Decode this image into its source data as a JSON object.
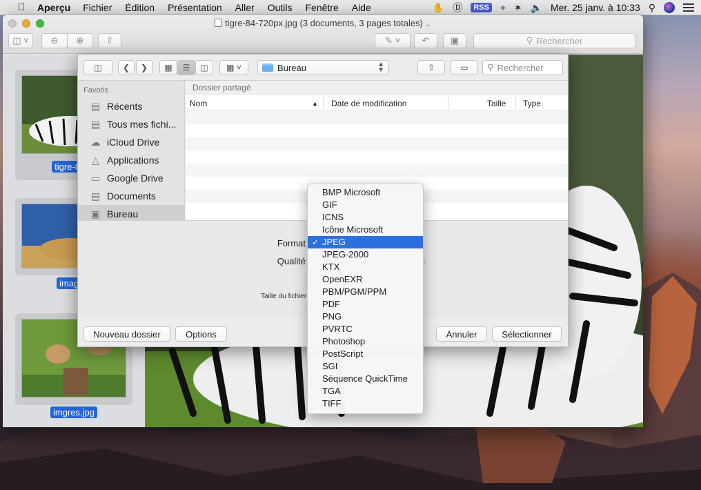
{
  "menubar": {
    "app_name": "Aperçu",
    "menus": [
      "Fichier",
      "Édition",
      "Présentation",
      "Aller",
      "Outils",
      "Fenêtre",
      "Aide"
    ],
    "rss_label": "RSS",
    "clock": "Mer. 25 janv. à  10:33"
  },
  "window": {
    "title": "tigre-84-720px.jpg (3 documents, 3 pages totales)",
    "search_placeholder": "Rechercher"
  },
  "thumbnails": [
    {
      "label": "tigre-84-7"
    },
    {
      "label": "images"
    },
    {
      "label": "imgres.jpg"
    }
  ],
  "sheet": {
    "location": "Bureau",
    "search_placeholder": "Rechercher",
    "favorites_header": "Favoris",
    "favorites": [
      {
        "label": "Récents",
        "icon": "recents-icon"
      },
      {
        "label": "Tous mes fichi...",
        "icon": "all-files-icon"
      },
      {
        "label": "iCloud Drive",
        "icon": "cloud-icon"
      },
      {
        "label": "Applications",
        "icon": "applications-icon"
      },
      {
        "label": "Google Drive",
        "icon": "folder-icon"
      },
      {
        "label": "Documents",
        "icon": "documents-icon"
      },
      {
        "label": "Bureau",
        "icon": "desktop-icon"
      }
    ],
    "shared_folder_header": "Dossier partagé",
    "columns": {
      "name": "Nom",
      "modified": "Date de modification",
      "size": "Taille",
      "type": "Type"
    },
    "format_label": "Format",
    "quality_label": "Qualité",
    "file_size_label": "Taille du fichier",
    "buttons": {
      "new_folder": "Nouveau dossier",
      "options": "Options",
      "cancel": "Annuler",
      "select": "Sélectionner"
    }
  },
  "format_menu": {
    "selected": "JPEG",
    "items": [
      "BMP Microsoft",
      "GIF",
      "ICNS",
      "Icône Microsoft",
      "JPEG",
      "JPEG-2000",
      "KTX",
      "OpenEXR",
      "PBM/PGM/PPM",
      "PDF",
      "PNG",
      "PVRTC",
      "Photoshop",
      "PostScript",
      "SGI",
      "Séquence QuickTime",
      "TGA",
      "TIFF"
    ]
  }
}
